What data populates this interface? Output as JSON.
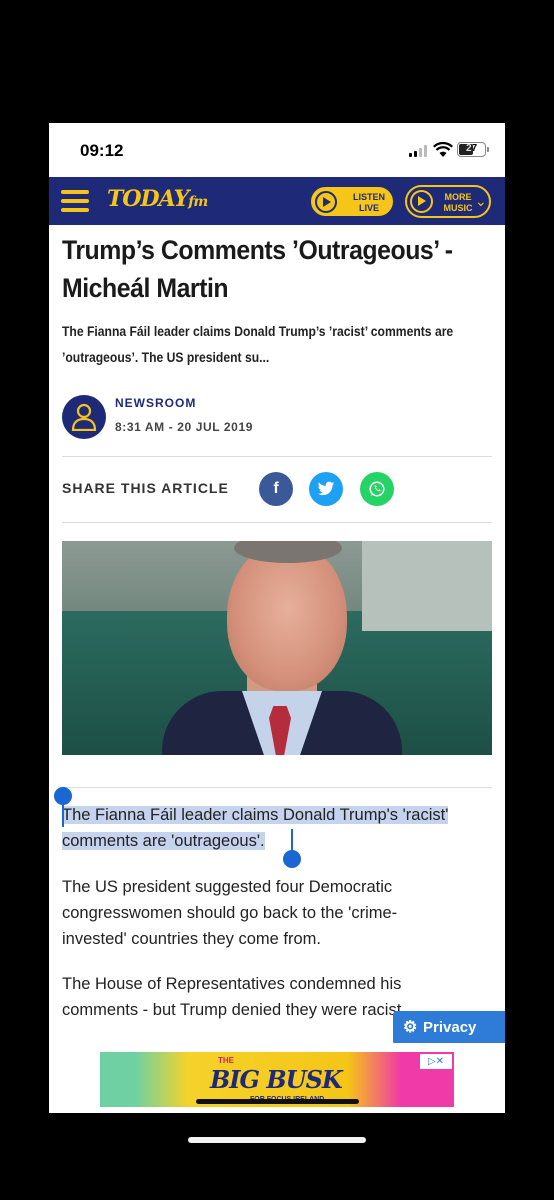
{
  "status_bar": {
    "time": "09:12",
    "battery": "27"
  },
  "site_header": {
    "logo": "TODAY",
    "logo_suffix": "fm",
    "listen_label_1": "LISTEN",
    "listen_label_2": "LIVE",
    "more_label_1": "MORE",
    "more_label_2": "MUSIC",
    "brand_color": "#1e2a78",
    "accent_color": "#f5c518"
  },
  "article": {
    "headline_line1": "Trump’s Comments ’Outrageous’ -",
    "headline_line2": "Micheál Martin",
    "standfirst_line1": "The Fianna Fáil leader claims Donald Trump’s ’racist’ comments are",
    "standfirst_line2": "’outrageous’. The US president su...",
    "author": "NEWSROOM",
    "date": "8:31 AM - 20 JUL 2019",
    "share_label": "SHARE THIS ARTICLE",
    "share_icons": [
      "facebook-icon",
      "twitter-icon",
      "whatsapp-icon"
    ],
    "paragraph1_line1": "The Fianna Fáil leader claims Donald Trump's 'racist'",
    "paragraph1_line2": "comments are 'outrageous'.",
    "paragraph2_line1": "The US president suggested four Democratic",
    "paragraph2_line2": "congresswomen should go back to the 'crime-",
    "paragraph2_line3": "invested' countries they come from.",
    "paragraph3_line1": "The House of Representatives condemned his",
    "paragraph3_line2": "comments - but Trump denied they were racist."
  },
  "privacy_button": {
    "label": "Privacy"
  },
  "ad": {
    "the": "THE",
    "title": "BIG BUSK",
    "subtitle": "FOR FOCUS IRELAND"
  }
}
